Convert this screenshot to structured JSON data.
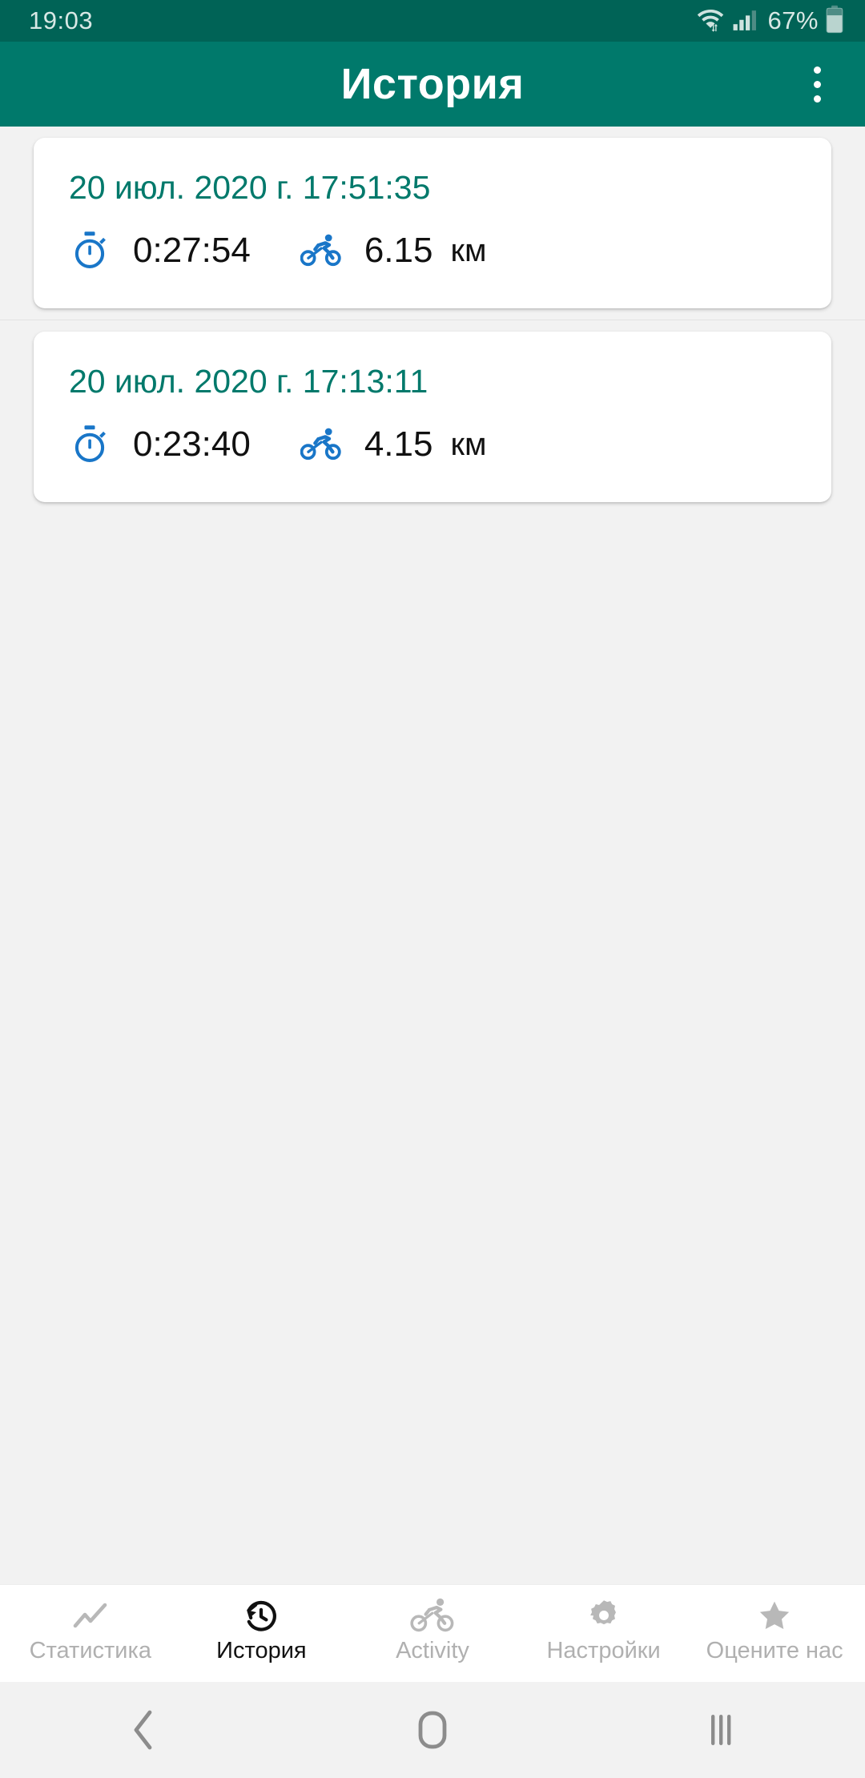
{
  "status_bar": {
    "clock": "19:03",
    "battery_percent": "67%",
    "icons": [
      "wifi-icon",
      "cellular-signal-icon",
      "battery-icon"
    ]
  },
  "app_bar": {
    "title": "История",
    "overflow_icon": "overflow-menu-icon"
  },
  "colors": {
    "status_bar_bg": "#006356",
    "app_bar_bg": "#00796b",
    "accent_teal": "#00796b",
    "icon_blue": "#1976c8",
    "page_bg": "#f2f2f2",
    "card_bg": "#ffffff",
    "value_text": "#111111",
    "tab_inactive": "#b0b0b0",
    "tab_active": "#111111"
  },
  "history": {
    "items": [
      {
        "date": "20 июл. 2020 г. 17:51:35",
        "duration": "0:27:54",
        "distance": "6.15",
        "unit": "км",
        "duration_icon": "stopwatch-icon",
        "distance_icon": "bicycle-icon"
      },
      {
        "date": "20 июл. 2020 г. 17:13:11",
        "duration": "0:23:40",
        "distance": "4.15",
        "unit": "км",
        "duration_icon": "stopwatch-icon",
        "distance_icon": "bicycle-icon"
      }
    ]
  },
  "tab_bar": {
    "tabs": [
      {
        "label": "Статистика",
        "icon": "trend-line-icon",
        "active": false
      },
      {
        "label": "История",
        "icon": "history-clock-icon",
        "active": true
      },
      {
        "label": "Activity",
        "icon": "bicycle-icon",
        "active": false
      },
      {
        "label": "Настройки",
        "icon": "gear-icon",
        "active": false
      },
      {
        "label": "Оцените нас",
        "icon": "star-icon",
        "active": false
      }
    ]
  },
  "system_nav": {
    "back_icon": "back-chevron-icon",
    "home_icon": "home-square-icon",
    "recents_icon": "recents-bars-icon"
  }
}
